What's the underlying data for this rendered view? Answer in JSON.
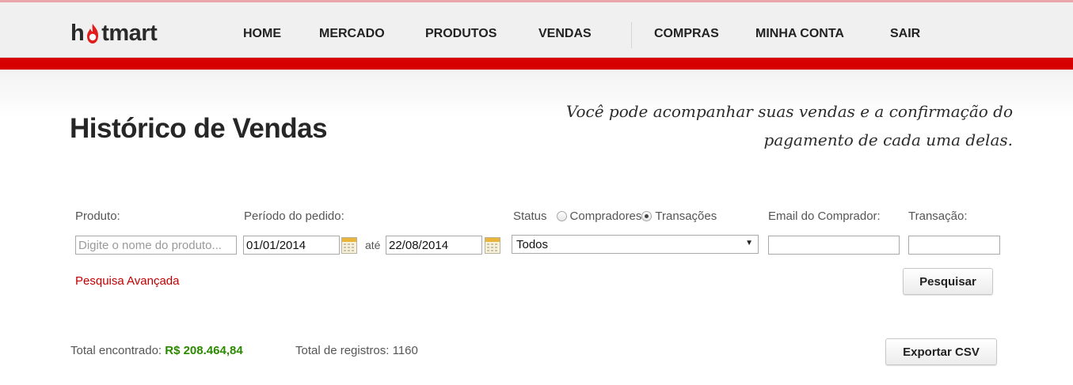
{
  "brand": {
    "logo_prefix": "h",
    "logo_suffix": "tmart",
    "accent": "#d60000"
  },
  "nav": {
    "items": [
      {
        "label": "HOME"
      },
      {
        "label": "MERCADO"
      },
      {
        "label": "PRODUTOS"
      },
      {
        "label": "VENDAS"
      },
      {
        "label": "COMPRAS"
      },
      {
        "label": "MINHA CONTA"
      },
      {
        "label": "SAIR"
      }
    ]
  },
  "page": {
    "title": "Histórico de Vendas",
    "subtitle_line1": "Você pode acompanhar suas vendas e a confirmação do",
    "subtitle_line2": "pagamento de cada uma delas."
  },
  "filters": {
    "produto_label": "Produto:",
    "produto_placeholder": "Digite o nome do produto...",
    "periodo_label": "Período do pedido:",
    "date_from": "01/01/2014",
    "ate_label": "até",
    "date_to": "22/08/2014",
    "status_label": "Status",
    "radio_compradores": "Compradores",
    "radio_transacoes": "Transações",
    "status_selected": "Todos",
    "email_label": "Email do Comprador:",
    "email_value": "",
    "transacao_label": "Transação:",
    "transacao_value": "",
    "advanced_link": "Pesquisa Avançada",
    "search_button": "Pesquisar"
  },
  "results": {
    "total_label": "Total encontrado:",
    "total_value": "R$ 208.464,84",
    "records_label": "Total de registros:",
    "records_value": "1160",
    "export_button": "Exportar CSV",
    "money_color": "#2a8a00"
  }
}
